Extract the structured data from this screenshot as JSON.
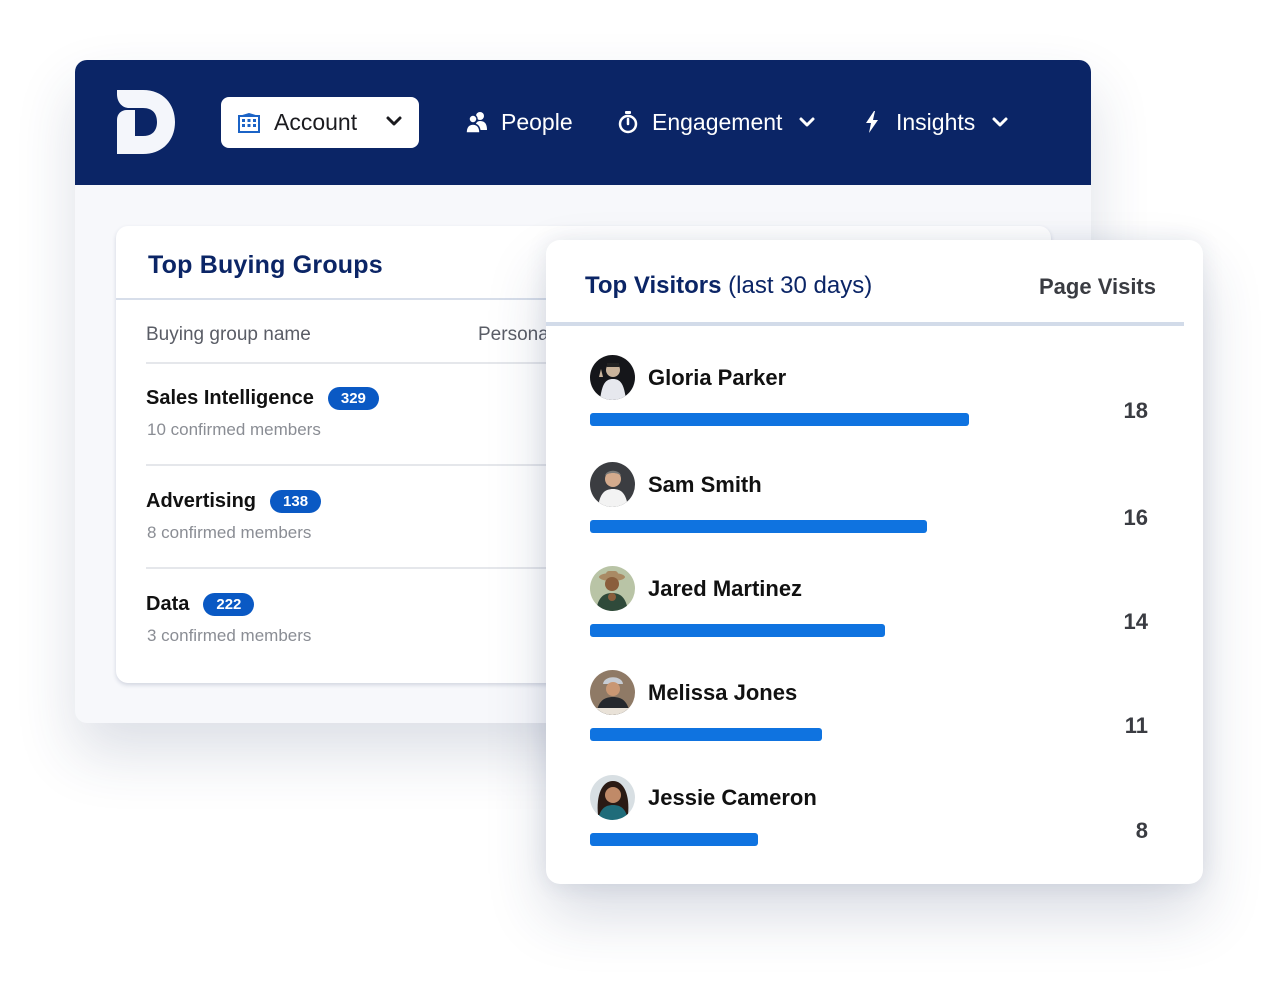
{
  "navbar": {
    "logo": "D",
    "account_select": {
      "icon": "building-icon",
      "label": "Account",
      "chevron": "chevron-down-icon"
    },
    "items": [
      {
        "icon": "people-icon",
        "label": "People",
        "has_dropdown": false
      },
      {
        "icon": "stopwatch-icon",
        "label": "Engagement",
        "has_dropdown": true
      },
      {
        "icon": "lightning-icon",
        "label": "Insights",
        "has_dropdown": true
      }
    ]
  },
  "buying_groups": {
    "title": "Top Buying Groups",
    "columns": [
      "Buying group name",
      "Persona"
    ],
    "rows": [
      {
        "name": "Sales Intelligence",
        "count": "329",
        "members": "10 confirmed members"
      },
      {
        "name": "Advertising",
        "count": "138",
        "members": "8 confirmed members"
      },
      {
        "name": "Data",
        "count": "222",
        "members": "3 confirmed members"
      }
    ]
  },
  "top_visitors": {
    "title": "Top Visitors",
    "subtitle": "(last 30 days)",
    "value_header": "Page Visits",
    "bar_color": "#0f73e0",
    "visitors": [
      {
        "name": "Gloria Parker",
        "visits": 18,
        "visits_label": "18"
      },
      {
        "name": "Sam Smith",
        "visits": 16,
        "visits_label": "16"
      },
      {
        "name": "Jared Martinez",
        "visits": 14,
        "visits_label": "14"
      },
      {
        "name": "Melissa Jones",
        "visits": 11,
        "visits_label": "11"
      },
      {
        "name": "Jessie Cameron",
        "visits": 8,
        "visits_label": "8"
      }
    ]
  },
  "colors": {
    "navy": "#0b2566",
    "badge": "#0a59c4",
    "bar": "#0f73e0"
  }
}
